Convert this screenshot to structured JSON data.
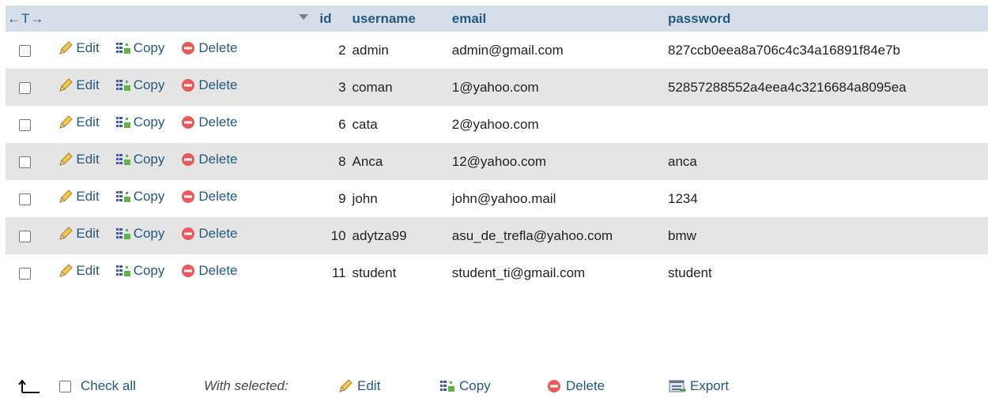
{
  "header": {
    "arrows": "←T→",
    "columns": [
      "id",
      "username",
      "email",
      "password"
    ]
  },
  "actions": {
    "edit": "Edit",
    "copy": "Copy",
    "delete": "Delete"
  },
  "rows": [
    {
      "id": "2",
      "username": "admin",
      "email": "admin@gmail.com",
      "password": "827ccb0eea8a706c4c34a16891f84e7b"
    },
    {
      "id": "3",
      "username": "coman",
      "email": "1@yahoo.com",
      "password": "52857288552a4eea4c3216684a8095ea"
    },
    {
      "id": "6",
      "username": "cata",
      "email": "2@yahoo.com",
      "password": ""
    },
    {
      "id": "8",
      "username": "Anca",
      "email": "12@yahoo.com",
      "password": "anca"
    },
    {
      "id": "9",
      "username": "john",
      "email": "john@yahoo.mail",
      "password": "1234"
    },
    {
      "id": "10",
      "username": "adytza99",
      "email": "asu_de_trefla@yahoo.com",
      "password": "bmw"
    },
    {
      "id": "11",
      "username": "student",
      "email": "student_ti@gmail.com",
      "password": "student"
    }
  ],
  "footer": {
    "check_all": "Check all",
    "with_selected": "With selected:",
    "edit": "Edit",
    "copy": "Copy",
    "delete": "Delete",
    "export": "Export"
  },
  "colors": {
    "link": "#235a81",
    "header_bg": "#d6dfe9",
    "row_alt_bg": "#e5e5e5",
    "delete_icon": "#e85a5a"
  },
  "icons": [
    "pencil-icon",
    "copy-icon",
    "delete-icon",
    "export-icon",
    "select-arrow-icon"
  ]
}
